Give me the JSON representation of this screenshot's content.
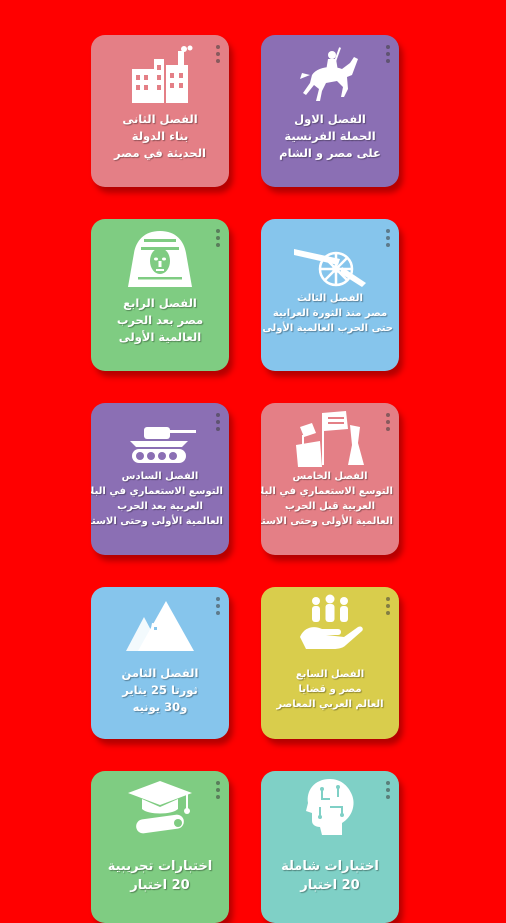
{
  "background_color": "#ff0000",
  "cards": [
    {
      "icon": "horseman-icon",
      "color": "#8b6fb4",
      "lines": [
        "الفصل الاول",
        "الحملة الفرنسية",
        "على مصر و الشام"
      ]
    },
    {
      "icon": "factory-icon",
      "color": "#e47f86",
      "lines": [
        "الفصل الثانى",
        "بناء الدولة",
        "الحديثة في مصر"
      ]
    },
    {
      "icon": "cannon-icon",
      "color": "#86c5ec",
      "lines": [
        "الفصل الثالث",
        "مصر منذ الثورة العرابية",
        "حتى الحرب العالمية الأولى"
      ]
    },
    {
      "icon": "sphinx-icon",
      "color": "#7fcc82",
      "lines": [
        "الفصل الرابع",
        "مصر بعد الحرب",
        "العالمية الأولى"
      ]
    },
    {
      "icon": "flags-icon",
      "color": "#e47f86",
      "lines": [
        "الفصل الخامس",
        "التوسع الاستعماري في البلاد",
        "العربية قبل الحرب",
        "العالمية الأولى وحتى الاستقلال"
      ]
    },
    {
      "icon": "tank-icon",
      "color": "#8b6fb4",
      "lines": [
        "الفصل السادس",
        "التوسع الاستعماري في البلاد",
        "العربية بعد الحرب",
        "العالمية الأولى وحتى الاستقلال"
      ]
    },
    {
      "icon": "people-hand-icon",
      "color": "#d9cd4c",
      "lines": [
        "الفصل السابع",
        "مصر و قضايا",
        "العالم العربي المعاصر"
      ]
    },
    {
      "icon": "pyramids-icon",
      "color": "#86c5ec",
      "lines": [
        "الفصل الثامن",
        "ثورتا 25 يناير",
        "و30 يونيه"
      ]
    },
    {
      "icon": "brain-circuit-icon",
      "color": "#7fd0c6",
      "lines": [
        "اختبارات شاملة",
        "20 اختبار"
      ]
    },
    {
      "icon": "graduation-icon",
      "color": "#7fcc82",
      "lines": [
        "اختبارات تجريبية",
        "20 اختبار"
      ]
    }
  ]
}
